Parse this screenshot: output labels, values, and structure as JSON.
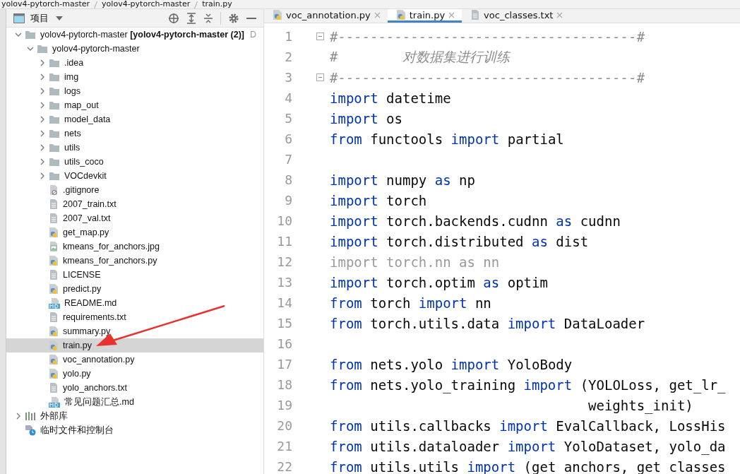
{
  "breadcrumb": [
    "yolov4-pytorch-master",
    "yolov4-pytorch-master",
    "train.py"
  ],
  "project_panel": {
    "title": "项目"
  },
  "tree": [
    {
      "kind": "folder",
      "label": "yolov4-pytorch-master **[yolov4-pytorch-master (2)]**",
      "hint": "D",
      "expanded": true,
      "selected": false,
      "children": [
        {
          "kind": "folder",
          "label": "yolov4-pytorch-master",
          "expanded": true,
          "selected": false,
          "children": [
            {
              "kind": "folder",
              "label": ".idea",
              "expanded": false,
              "selected": false
            },
            {
              "kind": "folder",
              "label": "img",
              "expanded": false,
              "selected": false
            },
            {
              "kind": "folder",
              "label": "logs",
              "expanded": false,
              "selected": false
            },
            {
              "kind": "folder",
              "label": "map_out",
              "expanded": false,
              "selected": false
            },
            {
              "kind": "folder",
              "label": "model_data",
              "expanded": false,
              "selected": false
            },
            {
              "kind": "folder",
              "label": "nets",
              "expanded": false,
              "selected": false
            },
            {
              "kind": "folder",
              "label": "utils",
              "expanded": false,
              "selected": false
            },
            {
              "kind": "folder",
              "label": "utils_coco",
              "expanded": false,
              "selected": false
            },
            {
              "kind": "folder",
              "label": "VOCdevkit",
              "expanded": false,
              "selected": false
            },
            {
              "kind": "ignore",
              "label": ".gitignore",
              "selected": false
            },
            {
              "kind": "text",
              "label": "2007_train.txt",
              "selected": false
            },
            {
              "kind": "text",
              "label": "2007_val.txt",
              "selected": false
            },
            {
              "kind": "python",
              "label": "get_map.py",
              "selected": false
            },
            {
              "kind": "image",
              "label": "kmeans_for_anchors.jpg",
              "selected": false
            },
            {
              "kind": "python",
              "label": "kmeans_for_anchors.py",
              "selected": false
            },
            {
              "kind": "text",
              "label": "LICENSE",
              "selected": false
            },
            {
              "kind": "python",
              "label": "predict.py",
              "selected": false
            },
            {
              "kind": "markdown",
              "label": "README.md",
              "selected": false
            },
            {
              "kind": "text",
              "label": "requirements.txt",
              "selected": false
            },
            {
              "kind": "python",
              "label": "summary.py",
              "selected": false
            },
            {
              "kind": "python",
              "label": "train.py",
              "selected": true
            },
            {
              "kind": "python",
              "label": "voc_annotation.py",
              "selected": false
            },
            {
              "kind": "python",
              "label": "yolo.py",
              "selected": false
            },
            {
              "kind": "text",
              "label": "yolo_anchors.txt",
              "selected": false
            },
            {
              "kind": "markdown",
              "label": "常见问题汇总.md",
              "selected": false
            }
          ]
        }
      ]
    },
    {
      "kind": "library",
      "label": "外部库",
      "expanded": false,
      "selected": false
    },
    {
      "kind": "scratch",
      "label": "临时文件和控制台",
      "selected": false
    }
  ],
  "tabs": [
    {
      "kind": "python",
      "label": "voc_annotation.py",
      "selected": false
    },
    {
      "kind": "python",
      "label": "train.py",
      "selected": true
    },
    {
      "kind": "text",
      "label": "voc_classes.txt",
      "selected": false
    }
  ],
  "code": [
    {
      "number": "1",
      "fold": true,
      "tokens": [
        {
          "kind": "comment",
          "text": "#-------------------------------------#"
        }
      ]
    },
    {
      "number": "2",
      "fold": false,
      "tokens": [
        {
          "kind": "comment",
          "text": "#        对数据集进行训练"
        }
      ]
    },
    {
      "number": "3",
      "fold": true,
      "tokens": [
        {
          "kind": "comment",
          "text": "#-------------------------------------#"
        }
      ]
    },
    {
      "number": "4",
      "fold": false,
      "tokens": [
        {
          "kind": "keyword",
          "text": "import"
        },
        {
          "kind": "plain",
          "text": " datetime"
        }
      ]
    },
    {
      "number": "5",
      "fold": false,
      "tokens": [
        {
          "kind": "keyword",
          "text": "import"
        },
        {
          "kind": "plain",
          "text": " os"
        }
      ]
    },
    {
      "number": "6",
      "fold": false,
      "tokens": [
        {
          "kind": "keyword",
          "text": "from"
        },
        {
          "kind": "plain",
          "text": " functools "
        },
        {
          "kind": "keyword",
          "text": "import"
        },
        {
          "kind": "plain",
          "text": " partial"
        }
      ]
    },
    {
      "number": "7",
      "fold": false
    },
    {
      "number": "8",
      "fold": false,
      "tokens": [
        {
          "kind": "keyword",
          "text": "import"
        },
        {
          "kind": "plain",
          "text": " numpy "
        },
        {
          "kind": "keyword",
          "text": "as"
        },
        {
          "kind": "plain",
          "text": " np"
        }
      ]
    },
    {
      "number": "9",
      "fold": false,
      "tokens": [
        {
          "kind": "keyword",
          "text": "import"
        },
        {
          "kind": "plain",
          "text": " torch"
        }
      ]
    },
    {
      "number": "10",
      "fold": false,
      "tokens": [
        {
          "kind": "keyword",
          "text": "import"
        },
        {
          "kind": "plain",
          "text": " torch.backends.cudnn "
        },
        {
          "kind": "keyword",
          "text": "as"
        },
        {
          "kind": "plain",
          "text": " cudnn"
        }
      ]
    },
    {
      "number": "11",
      "fold": false,
      "tokens": [
        {
          "kind": "keyword",
          "text": "import"
        },
        {
          "kind": "plain",
          "text": " torch.distributed "
        },
        {
          "kind": "keyword",
          "text": "as"
        },
        {
          "kind": "plain",
          "text": " dist"
        }
      ]
    },
    {
      "number": "12",
      "fold": false,
      "tokens": [
        {
          "kind": "unused",
          "text": "import torch.nn as nn"
        }
      ]
    },
    {
      "number": "13",
      "fold": false,
      "tokens": [
        {
          "kind": "keyword",
          "text": "import"
        },
        {
          "kind": "plain",
          "text": " torch.optim "
        },
        {
          "kind": "keyword",
          "text": "as"
        },
        {
          "kind": "plain",
          "text": " optim"
        }
      ]
    },
    {
      "number": "14",
      "fold": false,
      "tokens": [
        {
          "kind": "keyword",
          "text": "from"
        },
        {
          "kind": "plain",
          "text": " torch "
        },
        {
          "kind": "keyword",
          "text": "import"
        },
        {
          "kind": "plain",
          "text": " nn"
        }
      ]
    },
    {
      "number": "15",
      "fold": false,
      "tokens": [
        {
          "kind": "keyword",
          "text": "from"
        },
        {
          "kind": "plain",
          "text": " torch.utils.data "
        },
        {
          "kind": "keyword",
          "text": "import"
        },
        {
          "kind": "plain",
          "text": " DataLoader"
        }
      ]
    },
    {
      "number": "16",
      "fold": false
    },
    {
      "number": "17",
      "fold": false,
      "tokens": [
        {
          "kind": "keyword",
          "text": "from"
        },
        {
          "kind": "plain",
          "text": " nets.yolo "
        },
        {
          "kind": "keyword",
          "text": "import"
        },
        {
          "kind": "plain",
          "text": " YoloBody"
        }
      ]
    },
    {
      "number": "18",
      "fold": false,
      "tokens": [
        {
          "kind": "keyword",
          "text": "from"
        },
        {
          "kind": "plain",
          "text": " nets.yolo_training "
        },
        {
          "kind": "keyword",
          "text": "import"
        },
        {
          "kind": "plain",
          "text": " (YOLOLoss, get_lr_"
        }
      ]
    },
    {
      "number": "19",
      "fold": false,
      "tokens": [
        {
          "kind": "plain",
          "text": "                                weights_init)"
        }
      ]
    },
    {
      "number": "20",
      "fold": false,
      "tokens": [
        {
          "kind": "keyword",
          "text": "from"
        },
        {
          "kind": "plain",
          "text": " utils.callbacks "
        },
        {
          "kind": "keyword",
          "text": "import"
        },
        {
          "kind": "plain",
          "text": " EvalCallback, LossHis"
        }
      ]
    },
    {
      "number": "21",
      "fold": false,
      "tokens": [
        {
          "kind": "keyword",
          "text": "from"
        },
        {
          "kind": "plain",
          "text": " utils.dataloader "
        },
        {
          "kind": "keyword",
          "text": "import"
        },
        {
          "kind": "plain",
          "text": " YoloDataset, yolo_da"
        }
      ]
    },
    {
      "number": "22",
      "fold": false,
      "tokens": [
        {
          "kind": "keyword",
          "text": "from"
        },
        {
          "kind": "plain",
          "text": " utils.utils "
        },
        {
          "kind": "keyword",
          "text": "import"
        },
        {
          "kind": "plain",
          "text": " (get_anchors, get_classes"
        }
      ]
    }
  ]
}
